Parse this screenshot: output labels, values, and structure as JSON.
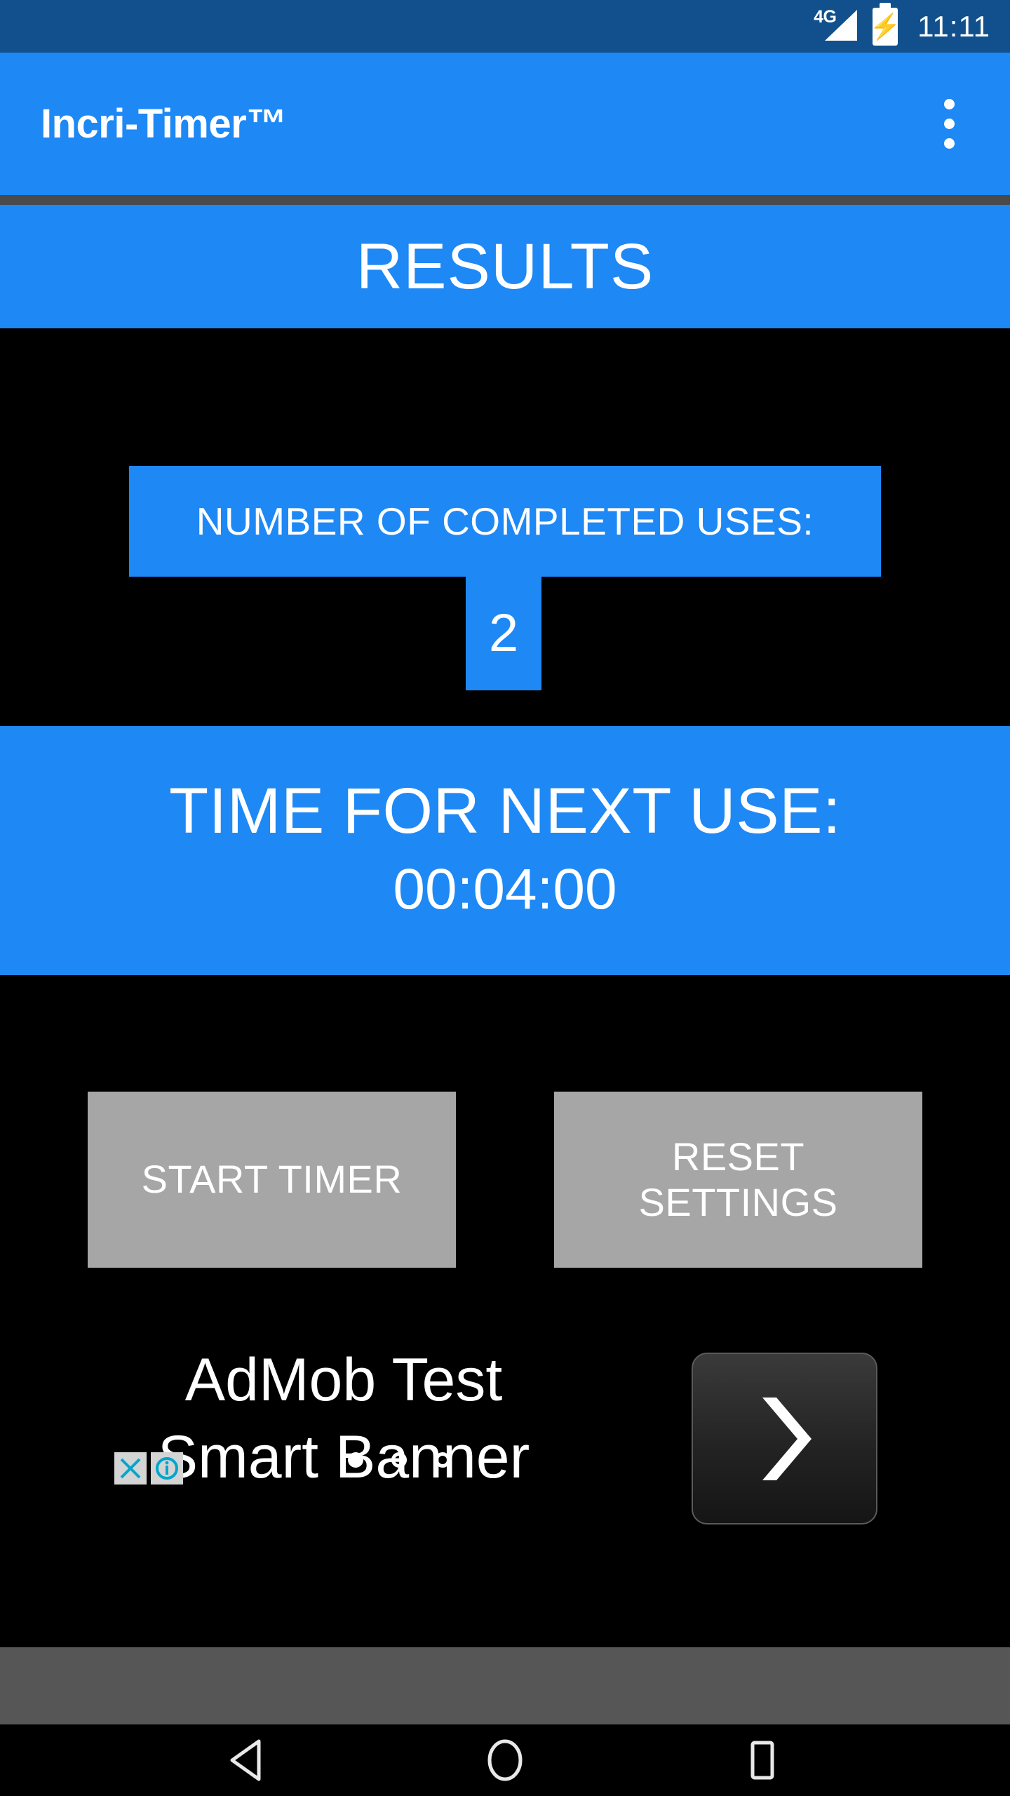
{
  "status_bar": {
    "network_label": "4G",
    "time": "11:11",
    "battery_icon": "battery-charging-icon",
    "signal_icon": "signal-bars-icon"
  },
  "app_bar": {
    "title": "Incri-Timer™",
    "overflow_icon": "more-vert-icon",
    "background_color": "#1E88F5"
  },
  "results": {
    "header": "RESULTS"
  },
  "completed_uses": {
    "label": "NUMBER OF COMPLETED USES:",
    "value": "2"
  },
  "next_use": {
    "label": "TIME FOR NEXT USE:",
    "time": "00:04:00"
  },
  "actions": {
    "start_label": "START TIMER",
    "reset_label": "RESET\nSETTINGS",
    "button_color": "#A6A6A6"
  },
  "ad": {
    "text": "AdMob Test\nSmart Banner",
    "next_icon": "chevron-right-icon",
    "close_icon": "close-icon",
    "info_icon": "info-icon",
    "dots": [
      "filled",
      "hollow",
      "hollow"
    ],
    "badge_color": "#00A6CE"
  },
  "nav_bar": {
    "back_icon": "triangle-back-icon",
    "home_icon": "circle-home-icon",
    "recents_icon": "square-recents-icon"
  },
  "colors": {
    "accent_blue": "#1E88F5",
    "status_blue": "#11508C",
    "background": "#000000",
    "gray_strip": "#565656"
  }
}
